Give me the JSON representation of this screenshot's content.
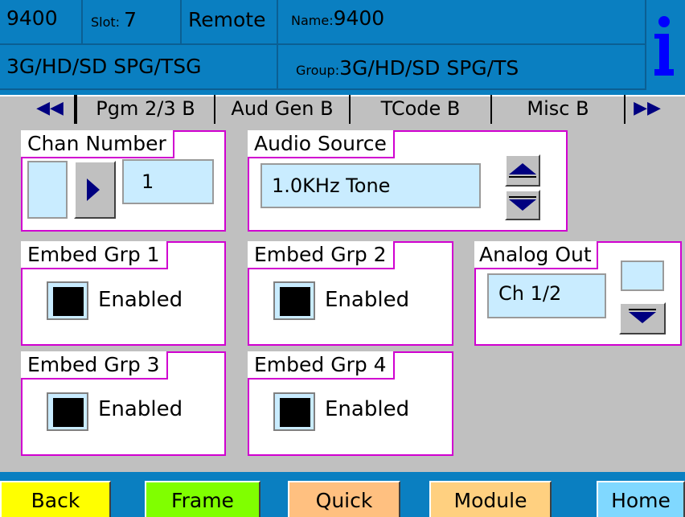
{
  "header": {
    "model": "9400",
    "slot_label": "Slot: ",
    "slot_value": "7",
    "mode": "Remote",
    "name_label": "Name:",
    "name_value": "9400",
    "card_type": "3G/HD/SD SPG/TSG",
    "group_label": "Group:",
    "group_value": "3G/HD/SD SPG/TS",
    "info_icon": "info-icon",
    "colors": {
      "header_bg": "#0a7fc1",
      "info_blue": "#0000ff"
    }
  },
  "tabs": {
    "prev_icon": "double-left-arrow-icon",
    "next_icon": "double-right-arrow-icon",
    "prev_glyph": "◀◀",
    "next_glyph": "▶▶",
    "items": [
      {
        "label": "Pgm 2/3 B"
      },
      {
        "label": "Aud Gen B"
      },
      {
        "label": "TCode B"
      },
      {
        "label": "Misc B"
      }
    ],
    "active_index": 1
  },
  "chan_number": {
    "title": "Chan Number",
    "value": "1"
  },
  "audio_source": {
    "title": "Audio Source",
    "value": "1.0KHz Tone"
  },
  "embed": [
    {
      "title": "Embed Grp 1",
      "state_label": "Enabled"
    },
    {
      "title": "Embed Grp 2",
      "state_label": "Enabled"
    },
    {
      "title": "Embed Grp 3",
      "state_label": "Enabled"
    },
    {
      "title": "Embed Grp 4",
      "state_label": "Enabled"
    }
  ],
  "analog_out": {
    "title": "Analog Out",
    "value": "Ch 1/2"
  },
  "nav": {
    "back": {
      "label": "Back",
      "color": "#ffff00"
    },
    "frame": {
      "label": "Frame",
      "color": "#80ff00"
    },
    "quick": {
      "label": "Quick",
      "color": "#ffc080"
    },
    "module": {
      "label": "Module",
      "color": "#ffd080"
    },
    "home": {
      "label": "Home",
      "color": "#80d8ff"
    }
  },
  "panel_border_color": "#d000d0",
  "field_color": "#c9ecff"
}
